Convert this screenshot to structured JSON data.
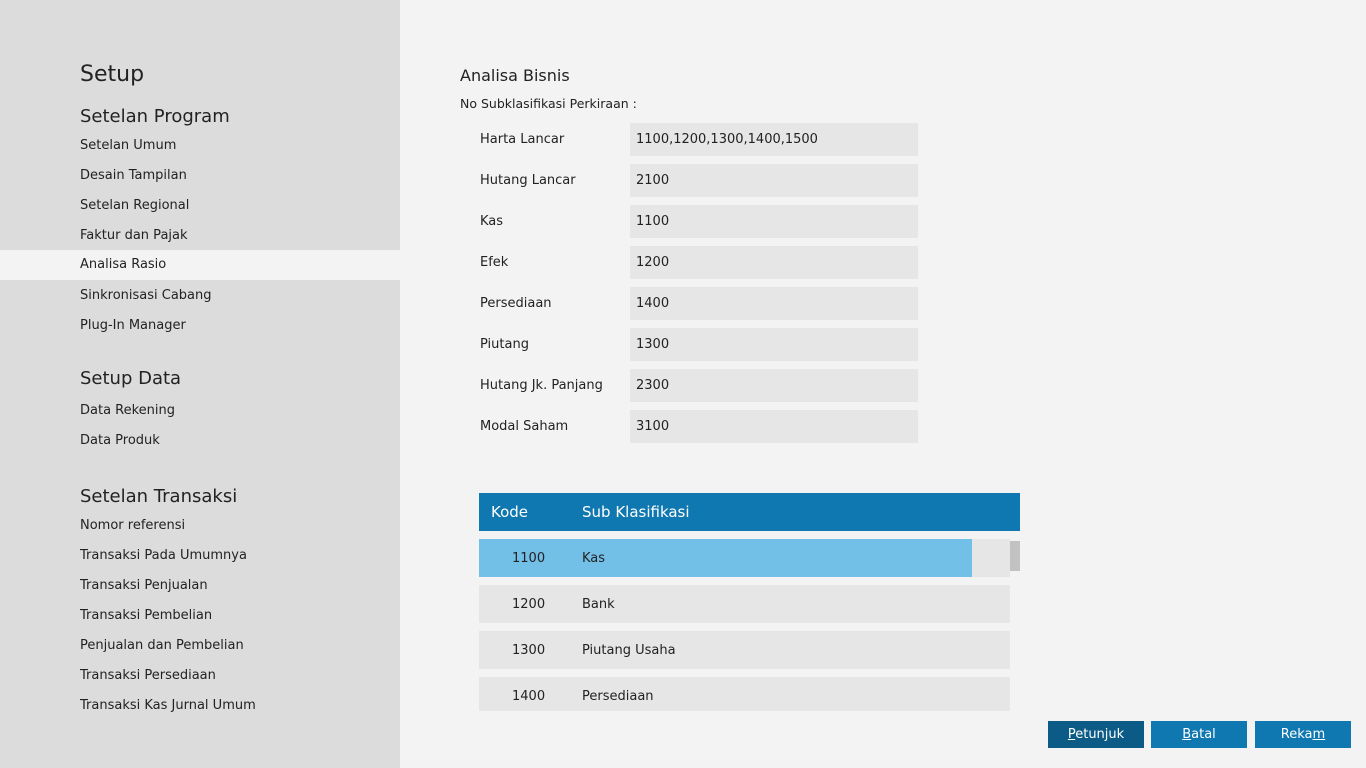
{
  "sidebar": {
    "title": "Setup",
    "groups": [
      {
        "label": "Setelan Program"
      },
      {
        "label": "Setup Data"
      },
      {
        "label": "Setelan Transaksi"
      }
    ],
    "program_items": [
      {
        "label": "Setelan Umum"
      },
      {
        "label": "Desain Tampilan"
      },
      {
        "label": "Setelan Regional"
      },
      {
        "label": "Faktur dan Pajak"
      },
      {
        "label": "Analisa Rasio"
      },
      {
        "label": "Sinkronisasi Cabang"
      },
      {
        "label": "Plug-In Manager"
      }
    ],
    "data_items": [
      {
        "label": "Data Rekening"
      },
      {
        "label": "Data Produk"
      }
    ],
    "transaksi_items": [
      {
        "label": "Nomor referensi"
      },
      {
        "label": "Transaksi Pada Umumnya"
      },
      {
        "label": "Transaksi Penjualan"
      },
      {
        "label": "Transaksi Pembelian"
      },
      {
        "label": "Penjualan dan Pembelian"
      },
      {
        "label": "Transaksi Persediaan"
      },
      {
        "label": "Transaksi Kas Jurnal Umum"
      }
    ],
    "active_item": "Analisa Rasio"
  },
  "main": {
    "title": "Analisa Bisnis",
    "subtitle": "No Subklasifikasi Perkiraan :",
    "fields": [
      {
        "label": "Harta Lancar",
        "value": "1100,1200,1300,1400,1500"
      },
      {
        "label": "Hutang Lancar",
        "value": "2100"
      },
      {
        "label": "Kas",
        "value": "1100"
      },
      {
        "label": "Efek",
        "value": "1200"
      },
      {
        "label": "Persediaan",
        "value": "1400"
      },
      {
        "label": "Piutang",
        "value": "1300"
      },
      {
        "label": "Hutang Jk. Panjang",
        "value": "2300"
      },
      {
        "label": "Modal Saham",
        "value": "3100"
      }
    ]
  },
  "table": {
    "columns": [
      "Kode",
      "Sub Klasifikasi"
    ],
    "rows": [
      {
        "kode": "1100",
        "sub": "Kas"
      },
      {
        "kode": "1200",
        "sub": "Bank"
      },
      {
        "kode": "1300",
        "sub": "Piutang Usaha"
      },
      {
        "kode": "1400",
        "sub": "Persediaan"
      }
    ],
    "selected_index": 0
  },
  "buttons": {
    "petunjuk": {
      "pre": "",
      "u": "P",
      "post": "etunjuk"
    },
    "batal": {
      "pre": "",
      "u": "B",
      "post": "atal"
    },
    "rekam": {
      "pre": "Reka",
      "u": "m",
      "post": ""
    }
  },
  "colors": {
    "sidebar_bg": "#dcdcdc",
    "accent": "#0f78b0",
    "accent_dark": "#0b5b86",
    "selection": "#72c0e8"
  }
}
